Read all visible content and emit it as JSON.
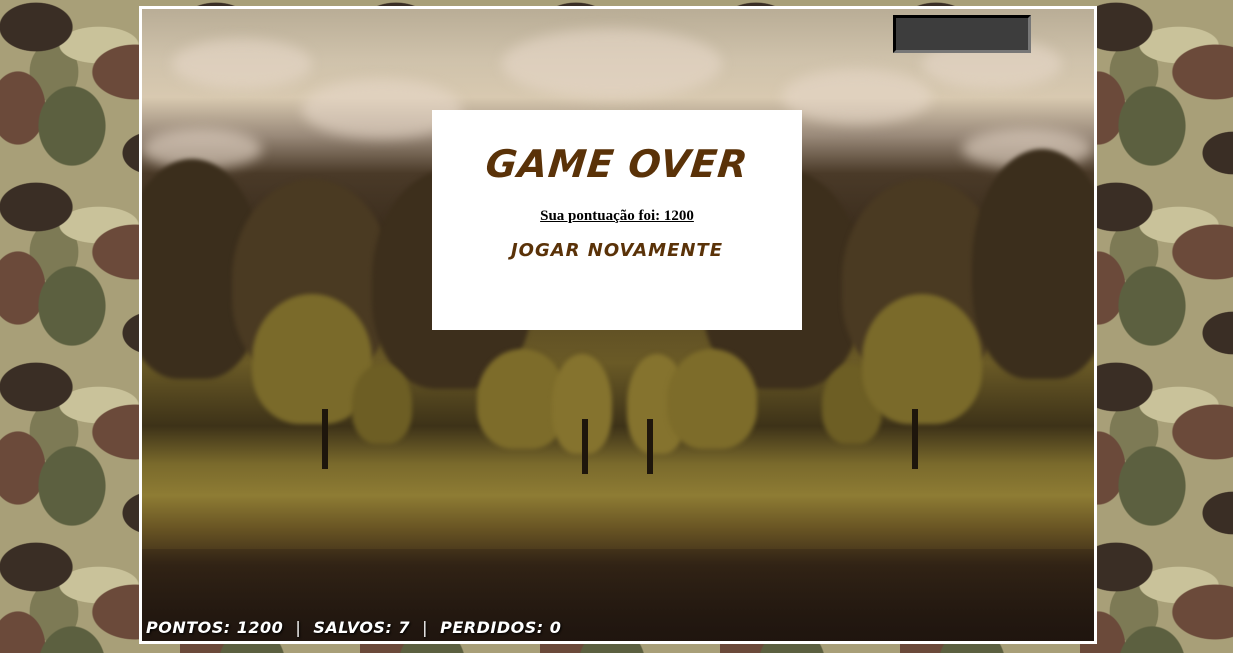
{
  "gameover": {
    "title": "GAME OVER",
    "score_text": "Sua pontuação foi: 1200",
    "play_again_label": "JOGAR NOVAMENTE"
  },
  "hud": {
    "points_label": "PONTOS:",
    "points_value": "1200",
    "saved_label": "SALVOS:",
    "saved_value": "7",
    "lost_label": "PERDIDOS:",
    "lost_value": "0",
    "separator": "|"
  },
  "colors": {
    "title": "#5a3208",
    "panel_bg": "#ffffff",
    "frame_border": "#ffffff",
    "top_slot": "#3d3d3d"
  },
  "icons": {
    "background": "camouflage-pattern",
    "scene": "forest-mirrored-landscape"
  }
}
